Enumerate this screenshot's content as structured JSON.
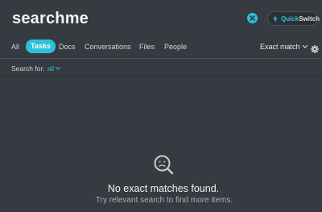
{
  "search": {
    "query": "searchme"
  },
  "quickswitch": {
    "quick": "Quick",
    "switch": "Switch"
  },
  "tabs": [
    {
      "label": "All",
      "active": false
    },
    {
      "label": "Tasks",
      "active": true
    },
    {
      "label": "Docs",
      "active": false
    },
    {
      "label": "Conversations",
      "active": false
    },
    {
      "label": "Files",
      "active": false
    },
    {
      "label": "People",
      "active": false
    }
  ],
  "match_mode": {
    "label": "Exact match"
  },
  "scope": {
    "label": "Search for:",
    "value": "all"
  },
  "empty_state": {
    "title": "No exact matches found.",
    "subtitle": "Try relevant search to find more items."
  },
  "icons": {
    "clear": "close-icon",
    "quickswitch": "lightning-icon",
    "match_dropdown": "chevron-down-icon",
    "settings": "gear-icon",
    "empty": "sad-search-icon"
  },
  "colors": {
    "accent": "#2cc1da",
    "background": "#363b41"
  }
}
